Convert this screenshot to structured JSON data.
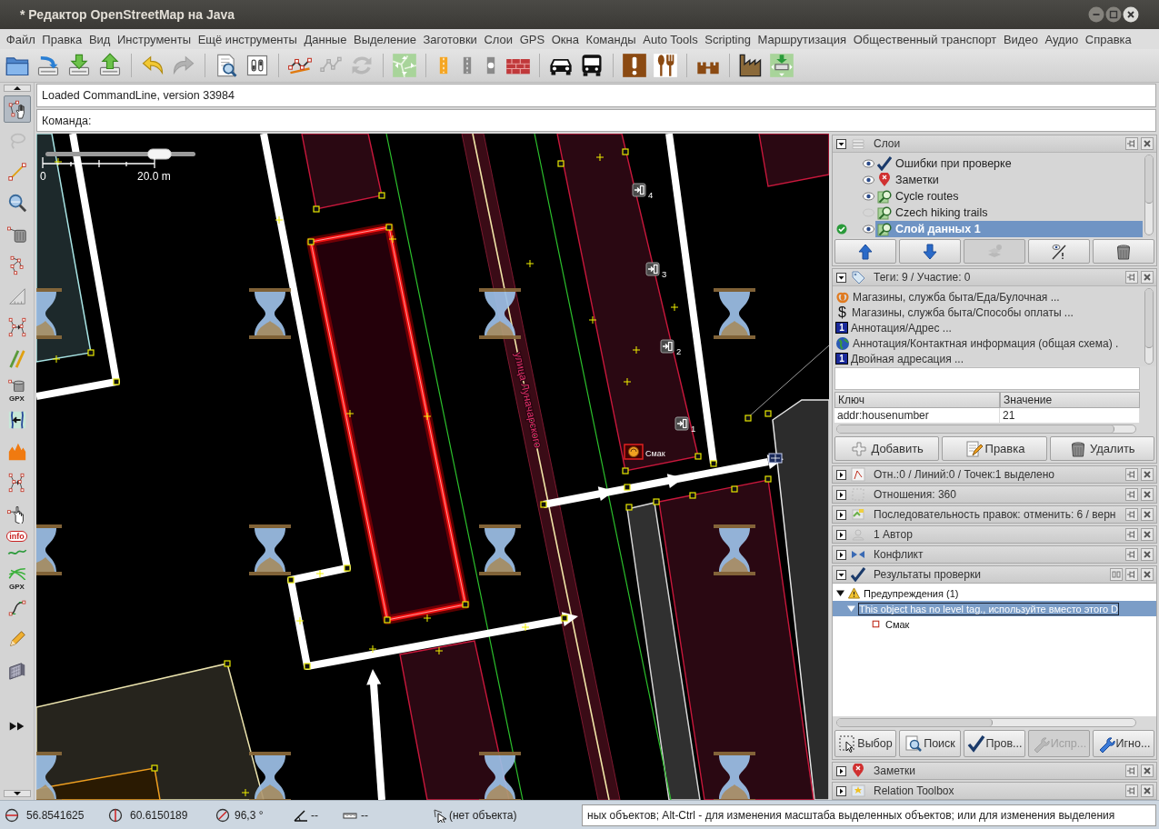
{
  "window": {
    "title": "* Редактор OpenStreetMap на Java"
  },
  "menu": [
    "Файл",
    "Правка",
    "Вид",
    "Инструменты",
    "Ещё инструменты",
    "Данные",
    "Выделение",
    "Заготовки",
    "Слои",
    "GPS",
    "Окна",
    "Команды",
    "Auto Tools",
    "Scripting",
    "Маршрутизация",
    "Общественный транспорт",
    "Видео",
    "Аудио",
    "Справка"
  ],
  "toolbar": [
    {
      "items": [
        {
          "kind": "open",
          "disabled": false
        },
        {
          "kind": "openurl",
          "disabled": false
        },
        {
          "kind": "download",
          "disabled": false
        },
        {
          "kind": "upload",
          "disabled": false
        }
      ]
    },
    {
      "items": [
        {
          "kind": "undo",
          "disabled": false
        },
        {
          "kind": "redo",
          "disabled": true
        }
      ]
    },
    {
      "items": [
        {
          "kind": "preview",
          "disabled": false
        },
        {
          "kind": "toggles",
          "disabled": false
        }
      ]
    },
    {
      "items": [
        {
          "kind": "wayedit",
          "disabled": false
        },
        {
          "kind": "nodes",
          "disabled": true
        },
        {
          "kind": "refresh",
          "disabled": true
        }
      ]
    },
    {
      "items": [
        {
          "kind": "mapmove",
          "disabled": false
        }
      ]
    },
    {
      "items": [
        {
          "kind": "roadmajor",
          "disabled": false
        },
        {
          "kind": "road",
          "disabled": false
        },
        {
          "kind": "roadcircle",
          "disabled": false
        },
        {
          "kind": "wall",
          "disabled": false
        }
      ]
    },
    {
      "items": [
        {
          "kind": "car",
          "disabled": false
        },
        {
          "kind": "bus",
          "disabled": false
        }
      ]
    },
    {
      "items": [
        {
          "kind": "alert",
          "disabled": false
        },
        {
          "kind": "food",
          "disabled": false
        }
      ]
    },
    {
      "items": [
        {
          "kind": "castle",
          "disabled": false
        }
      ]
    },
    {
      "items": [
        {
          "kind": "factory",
          "disabled": false
        },
        {
          "kind": "mapget",
          "disabled": false
        }
      ]
    }
  ],
  "command": {
    "output": "Loaded CommandLine, version 33984",
    "prompt": "Команда:"
  },
  "left_tools": [
    {
      "kind": "select",
      "selected": true,
      "disabled": false
    },
    {
      "kind": "lasso",
      "selected": false,
      "disabled": true
    },
    {
      "kind": "draw",
      "selected": false,
      "disabled": false
    },
    {
      "kind": "zoom",
      "selected": false,
      "disabled": false
    },
    {
      "kind": "delete",
      "selected": false,
      "disabled": false
    },
    {
      "kind": "improve",
      "selected": false,
      "disabled": false
    },
    {
      "kind": "measure",
      "selected": false,
      "disabled": false
    },
    {
      "kind": "split",
      "selected": false,
      "disabled": false
    },
    {
      "kind": "parallel",
      "selected": false,
      "disabled": false
    },
    {
      "kind": "gpxdelete",
      "caption": "GPX",
      "selected": false,
      "disabled": false
    },
    {
      "kind": "align",
      "selected": false,
      "disabled": false
    },
    {
      "kind": "elevation",
      "selected": false,
      "disabled": false
    },
    {
      "kind": "merge",
      "selected": false,
      "disabled": false
    },
    {
      "kind": "hand",
      "selected": false,
      "disabled": false
    },
    {
      "kind": "info",
      "caption": "info",
      "selected": false,
      "disabled": false
    },
    {
      "kind": "gpx",
      "caption": "GPX",
      "selected": false,
      "disabled": false
    },
    {
      "kind": "curve",
      "selected": false,
      "disabled": false
    },
    {
      "kind": "pencil",
      "selected": false,
      "disabled": false
    },
    {
      "kind": "grid",
      "selected": false,
      "disabled": false
    },
    {
      "kind": "more",
      "selected": false,
      "disabled": false
    }
  ],
  "map": {
    "scale": {
      "level": 0.76,
      "start": "0",
      "end": "20.0 m"
    },
    "street_label": "улица Луначарского",
    "entrances": [
      "4",
      "3",
      "2",
      "1"
    ],
    "poi": {
      "name": "Смак",
      "selected": true
    }
  },
  "layers_panel": {
    "title": "Слои",
    "expanded": true,
    "layers": [
      {
        "name": "Ошибки при проверке",
        "kind": "validation",
        "visible": true,
        "active": false,
        "selected": false
      },
      {
        "name": "Заметки",
        "kind": "notes",
        "visible": true,
        "active": false,
        "selected": false
      },
      {
        "name": "Cycle routes",
        "kind": "imagery",
        "visible": true,
        "active": false,
        "selected": false
      },
      {
        "name": "Czech hiking trails",
        "kind": "imagery",
        "visible": false,
        "active": false,
        "selected": false
      },
      {
        "name": "Слой данных 1",
        "kind": "data",
        "visible": true,
        "active": true,
        "selected": true
      }
    ],
    "buttons": [
      {
        "kind": "up",
        "disabled": false
      },
      {
        "kind": "down",
        "disabled": false
      },
      {
        "kind": "merge",
        "disabled": true
      },
      {
        "kind": "visibility",
        "disabled": false
      },
      {
        "kind": "delete",
        "disabled": false
      }
    ]
  },
  "tags_panel": {
    "title": "Теги: 9 / Участие: 0",
    "expanded": true,
    "presets": [
      {
        "kind": "bakery",
        "text": "Магазины, служба быта/Еда/Булочная ..."
      },
      {
        "kind": "payment",
        "icon_char": "$",
        "text": "Магазины, служба быта/Способы оплаты ..."
      },
      {
        "kind": "address",
        "icon_char": "1",
        "text": "Аннотация/Адрес ..."
      },
      {
        "kind": "contact",
        "text": "Аннотация/Контактная информация (общая схема) ."
      },
      {
        "kind": "address",
        "icon_char": "1",
        "text": "Двойная адресация ..."
      }
    ],
    "columns": [
      "Ключ",
      "Значение"
    ],
    "rows": [
      {
        "key": "addr:housenumber",
        "value": "21"
      }
    ],
    "buttons": [
      {
        "kind": "add",
        "label": "Добавить",
        "disabled": false
      },
      {
        "kind": "edit",
        "label": "Правка",
        "disabled": false
      },
      {
        "kind": "delete",
        "label": "Удалить",
        "disabled": false
      }
    ]
  },
  "side_panels": [
    {
      "kind": "selection",
      "title": "Отн.:0 / Линий:0 / Точек:1 выделено",
      "expanded": false
    },
    {
      "kind": "relations",
      "title": "Отношения: 360",
      "expanded": false
    },
    {
      "kind": "history",
      "title": "Последовательность правок: отменить: 6 / верн",
      "expanded": false
    },
    {
      "kind": "authors",
      "title": "1 Автор",
      "expanded": false
    },
    {
      "kind": "conflict",
      "title": "Конфликт",
      "expanded": false
    }
  ],
  "validation_panel": {
    "title": "Результаты проверки",
    "expanded": true,
    "tree": [
      {
        "kind": "warnings",
        "label": "Предупреждения (1)",
        "expanded": true,
        "selected": false,
        "children": [
          {
            "label": "This object has no level tag., используйте вместо этого D",
            "expanded": true,
            "selected": true,
            "children": [
              {
                "kind": "node",
                "label": "Смак",
                "selected": false
              }
            ]
          }
        ]
      }
    ],
    "buttons": [
      {
        "kind": "select",
        "label": "Выбор",
        "disabled": false
      },
      {
        "kind": "search",
        "label": "Поиск",
        "disabled": false
      },
      {
        "kind": "validate",
        "label": "Пров...",
        "disabled": false
      },
      {
        "kind": "fix",
        "label": "Испр...",
        "disabled": true
      },
      {
        "kind": "ignore",
        "label": "Игно...",
        "disabled": false
      }
    ]
  },
  "bottom_panels": [
    {
      "kind": "notes",
      "title": "Заметки",
      "expanded": false
    },
    {
      "kind": "toolbox",
      "title": "Relation Toolbox",
      "expanded": false
    }
  ],
  "status_bar": {
    "fields": [
      {
        "kind": "lat",
        "text": "56.8541625"
      },
      {
        "kind": "lon",
        "text": "60.6150189"
      },
      {
        "kind": "heading",
        "text": "96,3 °"
      },
      {
        "kind": "angle",
        "text": "--"
      },
      {
        "kind": "distance",
        "text": "--"
      },
      {
        "kind": "object",
        "text": "(нет объекта)"
      }
    ],
    "help": "ных объектов; Alt-Ctrl - для изменения масштаба выделенных объектов; или для изменения выделения"
  }
}
